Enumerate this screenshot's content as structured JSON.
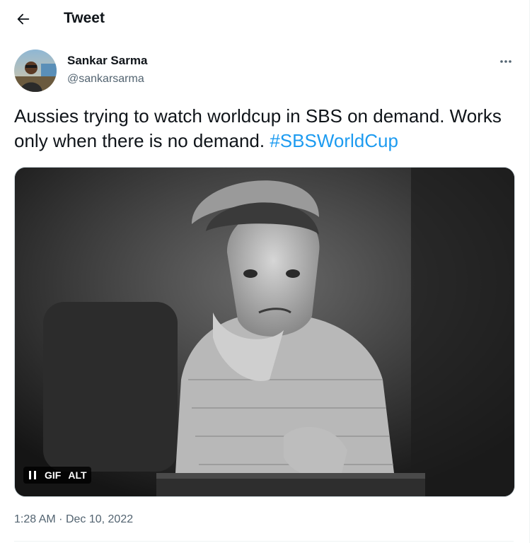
{
  "header": {
    "title": "Tweet",
    "back_icon": "arrow-left-icon"
  },
  "author": {
    "name": "Sankar Sarma",
    "handle": "@sankarsarma",
    "avatar": "user-photo-avatar"
  },
  "more_icon": "ellipsis-icon",
  "tweet": {
    "text": "Aussies trying to watch worldcup in SBS on demand. Works only when there is no demand. ",
    "hashtag": "#SBSWorldCup"
  },
  "media": {
    "type": "gif",
    "pause_icon": "pause-icon",
    "gif_label": "GIF",
    "alt_label": "ALT"
  },
  "meta": {
    "time": "1:28 AM",
    "separator": "·",
    "date": "Dec 10, 2022"
  },
  "colors": {
    "text": "#0f1419",
    "secondary": "#536471",
    "link": "#1d9bf0",
    "border": "#cfd9de"
  }
}
